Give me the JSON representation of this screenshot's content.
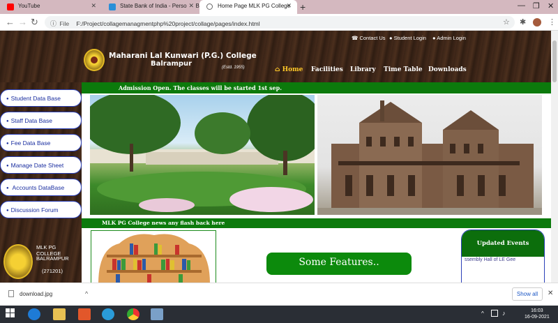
{
  "browser": {
    "tabs": [
      {
        "title": "YouTube",
        "active": false
      },
      {
        "title": "State Bank of India - Personal Ba",
        "active": false
      },
      {
        "title": "Home Page MLK PG College",
        "active": true
      }
    ],
    "address_label": "File",
    "url": "F:/Project/collagemanagmentphp%20project/collage/pages/index.html"
  },
  "header": {
    "college_name": "Maharani Lal Kunwari (P.G.) College",
    "college_city": "Balrampur",
    "estd": "(Estd. 1955)",
    "top_links": [
      "Contact Us",
      "Student Login",
      "Admin Login"
    ],
    "nav": [
      "Home",
      "Facilities",
      "Library",
      "Time Table",
      "Downloads"
    ]
  },
  "sidebar": {
    "items": [
      "Student Data Base",
      "Staff Data Base",
      "Fee Data Base",
      "Manage Date Sheet",
      "Accounts DataBase",
      "Discussion Forum"
    ],
    "logo_lines": [
      "MLK PG COLLEGE",
      "BALRAMPUR",
      "(271201)"
    ]
  },
  "main": {
    "admission_text": "Admission Open. The classes will be started 1st sep.",
    "news_text": "MLK PG College news any flash back here",
    "features_label": "Some Features..",
    "events_title": "Updated Events",
    "events_scroll": "ssembly Hall of LE Gee"
  },
  "downloads": {
    "file": "download.jpg",
    "show_all": "Show all"
  },
  "taskbar": {
    "time": "16:03",
    "date": "16-09-2021"
  },
  "colors": {
    "header_bg": "#3a2417",
    "accent_green": "#0c7a0c",
    "sidebar_text": "#1a2ea0",
    "home_highlight": "#ffc928"
  }
}
